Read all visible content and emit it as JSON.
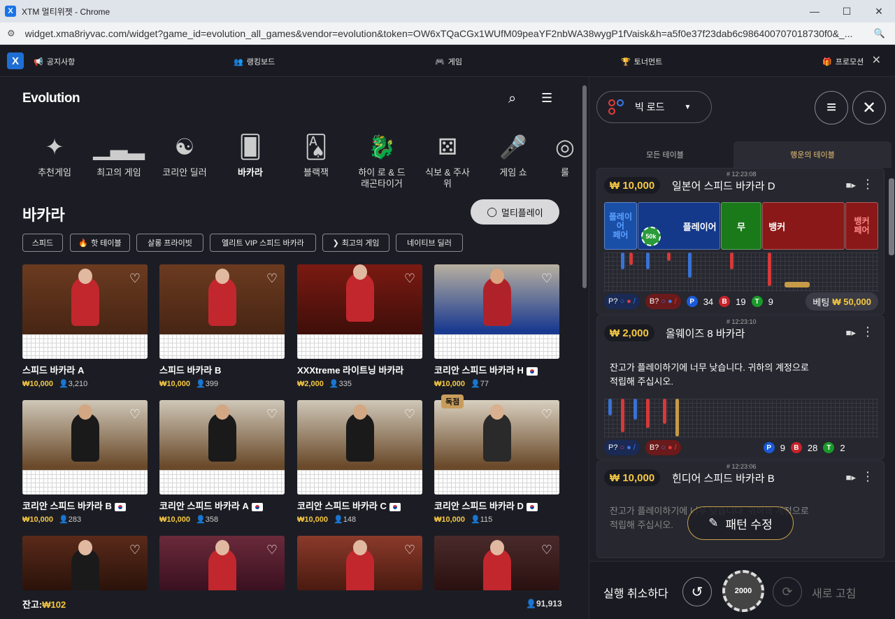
{
  "window": {
    "title": "XTM 멀티위젯 - Chrome",
    "app_icon": "X",
    "controls": [
      "—",
      "☐",
      "✕"
    ]
  },
  "address": {
    "url": "widget.xma8riyvac.com/widget?game_id=evolution_all_games&vendor=evolution&token=OW6xTQaCGx1WUfM09peaYF2nbWA38wygP1fVaisk&h=a5f0e37f23dab6c986400707018730f0&_..."
  },
  "topnav": {
    "logo": "X",
    "items": [
      {
        "icon": "megaphone-icon",
        "label": "공지사항"
      },
      {
        "icon": "users-icon",
        "label": "랭킹보드"
      },
      {
        "icon": "gamepad-icon",
        "label": "게임"
      },
      {
        "icon": "trophy-icon",
        "label": "토너먼트"
      },
      {
        "icon": "gift-icon",
        "label": "프로모션"
      }
    ]
  },
  "left": {
    "brand": "Evolution",
    "categories": [
      {
        "label": "추천게임",
        "icon": "sparkle-icon"
      },
      {
        "label": "최고의 게임",
        "icon": "podium-icon"
      },
      {
        "label": "코리안 딜러",
        "icon": "korea-icon"
      },
      {
        "label": "바카라",
        "icon": "baccarat-icon",
        "active": true
      },
      {
        "label": "블랙잭",
        "icon": "cards-icon"
      },
      {
        "label": "하이 로 & 드\n래곤타이거",
        "icon": "dragon-icon"
      },
      {
        "label": "식보 & 주사\n위",
        "icon": "dice-icon"
      },
      {
        "label": "게임 쇼",
        "icon": "microphone-icon"
      },
      {
        "label": "룰",
        "icon": "roulette-icon"
      }
    ],
    "section_title": "바카라",
    "multiplay_label": "멀티플레이",
    "chips": [
      "스피드",
      "핫 테이블",
      "살롱 프라이빗",
      "엘리트 VIP 스피드 바카라",
      "최고의 게임",
      "네이티브 딜러"
    ],
    "games": [
      {
        "name": "스피드 바카라 A",
        "limit": "₩10,000",
        "players": "3,210",
        "flag": false
      },
      {
        "name": "스피드 바카라 B",
        "limit": "₩10,000",
        "players": "399",
        "flag": false
      },
      {
        "name": "XXXtreme 라이트닝 바카라",
        "limit": "₩2,000",
        "players": "335",
        "flag": false
      },
      {
        "name": "코리안 스피드 바카라 H",
        "limit": "₩10,000",
        "players": "77",
        "flag": true
      },
      {
        "name": "코리안 스피드 바카라 B",
        "limit": "₩10,000",
        "players": "283",
        "flag": true
      },
      {
        "name": "코리안 스피드 바카라 A",
        "limit": "₩10,000",
        "players": "358",
        "flag": true
      },
      {
        "name": "코리안 스피드 바카라 C",
        "limit": "₩10,000",
        "players": "148",
        "flag": true
      },
      {
        "name": "코리안 스피드 바카라 D",
        "limit": "₩10,000",
        "players": "115",
        "flag": true,
        "badge": "독점"
      }
    ],
    "balance_label": "잔고:",
    "balance_value": "₩102",
    "players_total": "91,913"
  },
  "right": {
    "road_label": "빅 로드",
    "tabs": [
      "모든 테이블",
      "행운의 테이블"
    ],
    "tables": [
      {
        "game_id": "# 12:23:08",
        "limit": "₩ 10,000",
        "name": "일본어 스피드 바카라 D",
        "bets": {
          "pp": "플레이\n어\n페어",
          "p": "플레이어",
          "tie": "무",
          "b": "뱅커",
          "bp": "뱅커\n페어"
        },
        "chip": "50k",
        "stats": {
          "pq": "P?",
          "bq": "B?",
          "p": "34",
          "b": "19",
          "t": "9",
          "p_letter": "P",
          "b_letter": "B",
          "t_letter": "T"
        },
        "betting_label": "베팅",
        "betting_value": "₩ 50,000"
      },
      {
        "game_id": "# 12:23:10",
        "limit": "₩ 2,000",
        "name": "올웨이즈 8 바카라",
        "low_balance": "잔고가 플레이하기에 너무 낮습니다. 귀하의 계정으로 적립해 주십시오.",
        "stats": {
          "pq": "P?",
          "bq": "B?",
          "p": "9",
          "b": "28",
          "t": "2",
          "p_letter": "P",
          "b_letter": "B",
          "t_letter": "T"
        }
      },
      {
        "game_id": "# 12:23:06",
        "limit": "₩ 10,000",
        "name": "힌디어 스피드 바카라 B",
        "low_balance": "잔고가 플레이하기에 너무 낮습니다. 귀하의 계정으로 적립해 주십시오."
      }
    ],
    "pattern_edit": "패턴 수정",
    "undo_label": "실행 취소하다",
    "chip_value": "2000",
    "refresh_label": "새로 고침"
  }
}
